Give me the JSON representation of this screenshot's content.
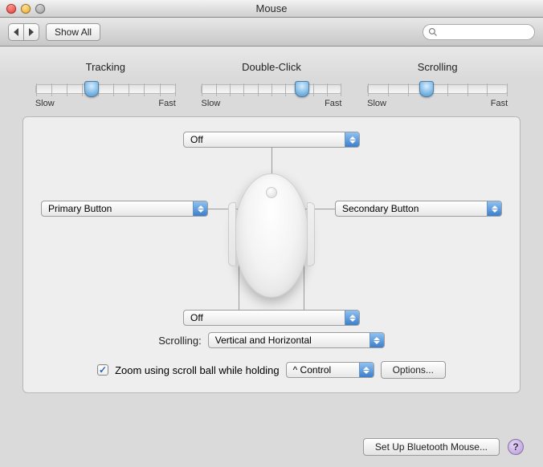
{
  "window": {
    "title": "Mouse"
  },
  "toolbar": {
    "show_all": "Show All",
    "search_placeholder": ""
  },
  "sliders": {
    "tracking": {
      "label": "Tracking",
      "min_label": "Slow",
      "max_label": "Fast",
      "ticks": 10,
      "value_pct": 40
    },
    "doubleclick": {
      "label": "Double-Click",
      "min_label": "Slow",
      "max_label": "Fast",
      "ticks": 11,
      "value_pct": 72
    },
    "scrolling": {
      "label": "Scrolling",
      "min_label": "Slow",
      "max_label": "Fast",
      "ticks": 8,
      "value_pct": 42
    }
  },
  "assignments": {
    "scroll_ball": "Off",
    "left_click": "Primary Button",
    "right_click": "Secondary Button",
    "side_buttons": "Off"
  },
  "scrolling_row": {
    "label": "Scrolling:",
    "value": "Vertical and Horizontal"
  },
  "zoom": {
    "checked": true,
    "label": "Zoom using scroll ball while holding",
    "modifier": "^ Control",
    "options_button": "Options..."
  },
  "footer": {
    "bluetooth_button": "Set Up Bluetooth Mouse..."
  }
}
